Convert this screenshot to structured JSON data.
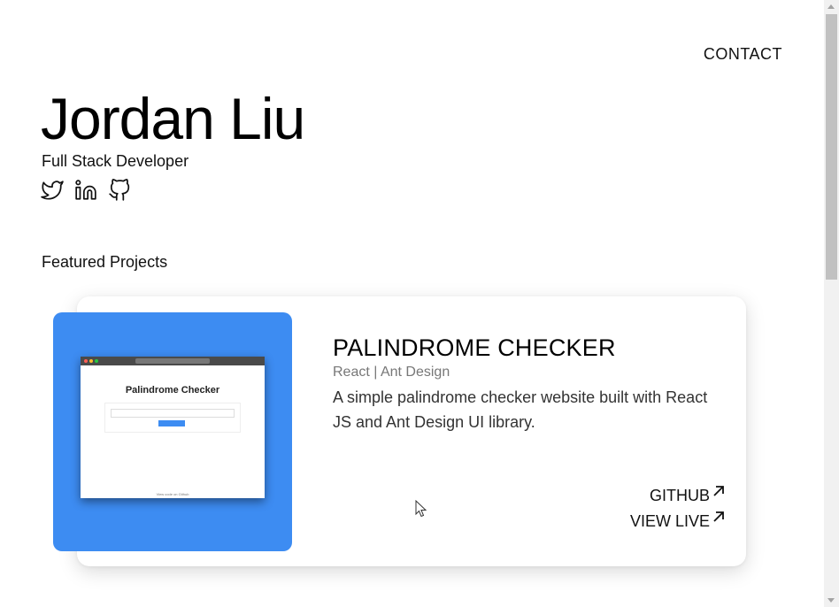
{
  "nav": {
    "contact_label": "CONTACT"
  },
  "hero": {
    "name": "Jordan Liu",
    "role": "Full Stack Developer",
    "socials": [
      "twitter-icon",
      "linkedin-icon",
      "github-icon"
    ]
  },
  "projects_section": {
    "title": "Featured Projects",
    "items": [
      {
        "title": "PALINDROME CHECKER",
        "tech": "React | Ant Design",
        "description": "A simple palindrome checker website built with React JS and Ant Design UI library.",
        "github_label": "GITHUB",
        "live_label": "VIEW LIVE",
        "thumbnail": {
          "app_title": "Palindrome Checker",
          "input_placeholder": "Enter text",
          "button_label": "Check",
          "footer": "View code on Github"
        }
      }
    ]
  },
  "colors": {
    "thumbnail_bg": "#3d8cf2",
    "text": "#111111",
    "muted": "#777777"
  }
}
